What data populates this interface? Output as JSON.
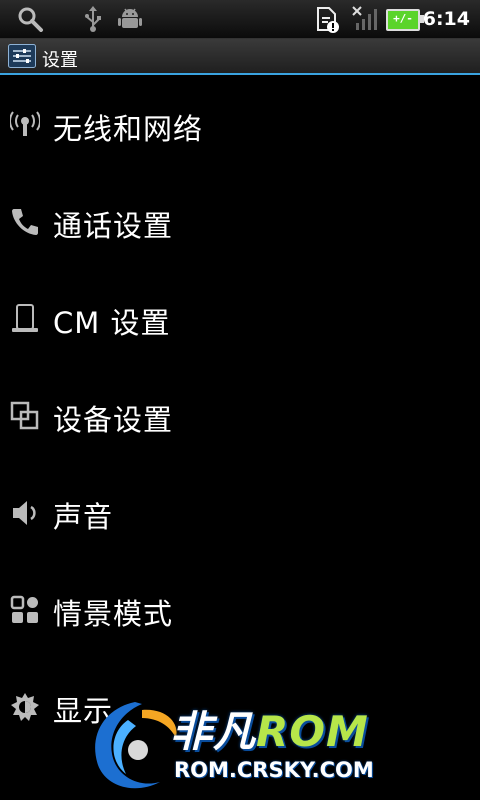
{
  "status_bar": {
    "time": "6:14",
    "battery_label": "+/-",
    "icons": [
      "search-icon",
      "usb-icon",
      "android-debug-icon",
      "sd-card-alert-icon",
      "no-signal-icon",
      "battery-charging-icon"
    ]
  },
  "title_bar": {
    "title": "设置",
    "icon": "settings-sliders-icon"
  },
  "settings": {
    "items": [
      {
        "label": "无线和网络",
        "icon": "wireless-icon"
      },
      {
        "label": "通话设置",
        "icon": "phone-icon"
      },
      {
        "label": "CM 设置",
        "icon": "device-icon"
      },
      {
        "label": "设备设置",
        "icon": "overlap-squares-icon"
      },
      {
        "label": "声音",
        "icon": "speaker-icon"
      },
      {
        "label": "情景模式",
        "icon": "grid-icon"
      },
      {
        "label": "显示",
        "icon": "brightness-icon"
      }
    ]
  },
  "watermark": {
    "brand_cn": "非凡",
    "brand_rom": "ROM",
    "url": "ROM.CRSKY.COM"
  },
  "colors": {
    "accent": "#3aa3e0",
    "battery_green": "#5bd42a",
    "background": "#000000"
  }
}
